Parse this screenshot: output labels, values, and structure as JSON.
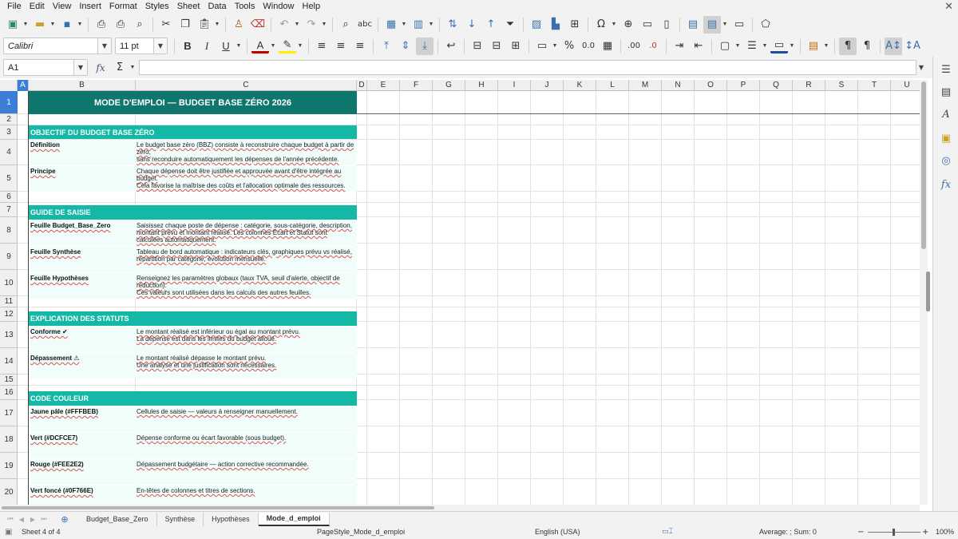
{
  "menu": [
    "File",
    "Edit",
    "View",
    "Insert",
    "Format",
    "Styles",
    "Sheet",
    "Data",
    "Tools",
    "Window",
    "Help"
  ],
  "font": {
    "name": "Calibri",
    "size": "11 pt"
  },
  "formula": {
    "cell_ref": "A1",
    "content": ""
  },
  "columns": [
    "A",
    "B",
    "C",
    "D",
    "E",
    "F",
    "G",
    "H",
    "I",
    "J",
    "K",
    "L",
    "M",
    "N",
    "O",
    "P",
    "Q",
    "R",
    "S",
    "T",
    "U"
  ],
  "rows": [
    "1",
    "2",
    "3",
    "4",
    "5",
    "6",
    "7",
    "8",
    "9",
    "10",
    "11",
    "12",
    "13",
    "14",
    "15",
    "16",
    "17",
    "18",
    "19",
    "20"
  ],
  "sheet": {
    "title": "MODE D'EMPLOI — BUDGET BASE ZÉRO 2026",
    "section_objective": {
      "header": "OBJECTIF DU BUDGET BASE ZÉRO",
      "definition_label": "Définition",
      "definition_text": [
        "Le budget base zéro (BBZ) consiste à reconstruire chaque budget à partir de zéro,",
        "sans reconduire automatiquement les dépenses de l'année précédente."
      ],
      "principle_label": "Principe",
      "principle_text": [
        "Chaque dépense doit être justifiée et approuvée avant d'être intégrée au budget.",
        "Cela favorise la maîtrise des coûts et l'allocation optimale des ressources."
      ]
    },
    "section_guide": {
      "header": "GUIDE DE SAISIE",
      "budget_label": "Feuille Budget_Base_Zero",
      "budget_text": [
        "Saisissez chaque poste de dépense : catégorie, sous-catégorie, description, montant prévu et montant réalisé. Les colonnes Écart et Statut sont calculées automatiquement."
      ],
      "synthese_label": "Feuille Synthèse",
      "synthese_text": [
        "Tableau de bord automatique : indicateurs clés, graphiques prévu vs réalisé, répartition par catégorie, évolution mensuelle."
      ],
      "hypotheses_label": "Feuille Hypothèses",
      "hypotheses_text": [
        "Renseignez les paramètres globaux (taux TVA, seuil d'alerte, objectif de réduction).",
        "Ces valeurs sont utilisées dans les calculs des autres feuilles."
      ]
    },
    "section_status": {
      "header": "EXPLICATION DES STATUTS",
      "conforme_label": "Conforme ✔",
      "conforme_text": [
        "Le montant réalisé est inférieur ou égal au montant prévu.",
        "La dépense est dans les limites du budget alloué."
      ],
      "depassement_label": "Dépassement ⚠",
      "depassement_text": [
        "Le montant réalisé dépasse le montant prévu.",
        "Une analyse et une justification sont nécessaires."
      ]
    },
    "section_colors": {
      "header": "CODE COULEUR",
      "yellow_label": "Jaune pâle (#FFFBEB)",
      "yellow_text": [
        "Cellules de saisie — valeurs à renseigner manuellement."
      ],
      "green_label": "Vert (#DCFCE7)",
      "green_text": [
        "Dépense conforme ou écart favorable (sous budget)."
      ],
      "red_label": "Rouge (#FEE2E2)",
      "red_text": [
        "Dépassement budgétaire — action corrective recommandée."
      ],
      "darkgreen_label": "Vert foncé (#0F766E)",
      "darkgreen_text": [
        "En-têtes de colonnes et titres de sections."
      ]
    }
  },
  "tabs": [
    "Budget_Base_Zero",
    "Synthèse",
    "Hypothèses",
    "Mode_d_emploi"
  ],
  "active_tab": "Mode_d_emploi",
  "status": {
    "sheet": "Sheet 4 of 4",
    "page_style": "PageStyle_Mode_d_emploi",
    "language": "English (USA)",
    "summary": "Average: ; Sum: 0",
    "zoom": "100%"
  },
  "colors": {
    "title_band": "#0f766e",
    "section_band": "#14b8a6",
    "row_tint": "#f0fdfa",
    "selection": "#3a7ed8"
  }
}
